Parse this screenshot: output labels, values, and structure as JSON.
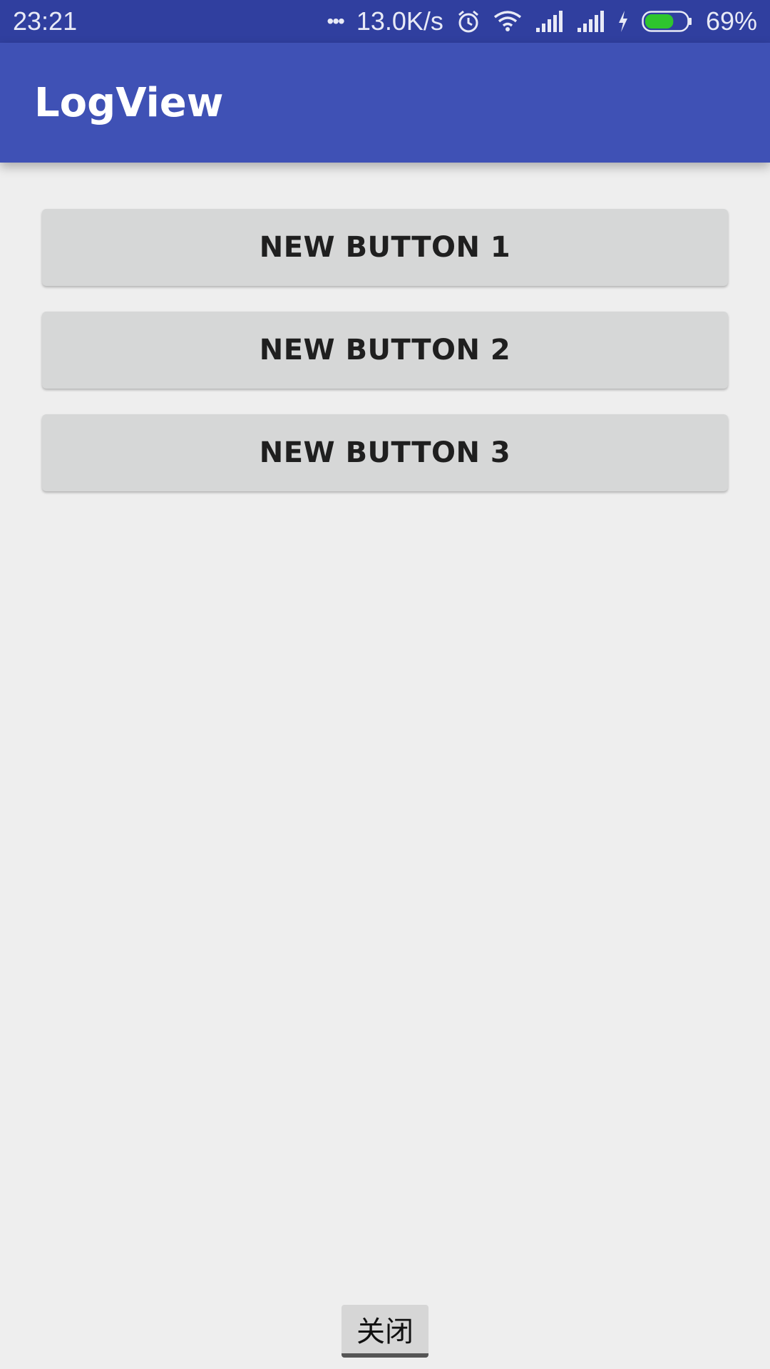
{
  "status_bar": {
    "time": "23:21",
    "dots": "•••",
    "net_speed": "13.0K/s",
    "battery_percent": "69%",
    "battery_level": 0.69,
    "icons": [
      "alarm-icon",
      "wifi-icon",
      "signal-icon",
      "signal-icon",
      "charging-icon",
      "battery-icon"
    ]
  },
  "app_bar": {
    "title": "LogView"
  },
  "buttons": [
    {
      "label": "NEW BUTTON 1"
    },
    {
      "label": "NEW BUTTON 2"
    },
    {
      "label": "NEW BUTTON 3"
    }
  ],
  "footer": {
    "close_label": "关闭"
  },
  "colors": {
    "status_bar": "#303f9f",
    "app_bar": "#3f51b5",
    "background": "#eeeeee",
    "button": "#d6d7d7",
    "battery_fill": "#2ec52e"
  }
}
